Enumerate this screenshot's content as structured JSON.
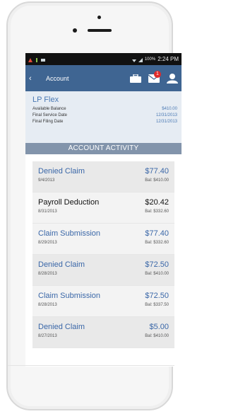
{
  "status_bar": {
    "time": "2:24 PM",
    "battery": "100%"
  },
  "app_bar": {
    "back_label": "‹",
    "title": "Account",
    "mail_badge": "1"
  },
  "summary": {
    "plan_name": "LP Flex",
    "rows": [
      {
        "label": "Available Balance",
        "value": "$410.00"
      },
      {
        "label": "Final Service Date",
        "value": "12/31/2013"
      },
      {
        "label": "Final Filing Date",
        "value": "12/31/2013"
      }
    ]
  },
  "section_title": "ACCOUNT ACTIVITY",
  "activity": [
    {
      "title": "Denied Claim",
      "amount": "$77.40",
      "date": "9/4/2013",
      "balance": "Bal: $410.00",
      "style": "blue"
    },
    {
      "title": "Payroll Deduction",
      "amount": "$20.42",
      "date": "8/31/2013",
      "balance": "Bal: $332.60",
      "style": "dark"
    },
    {
      "title": "Claim Submission",
      "amount": "$77.40",
      "date": "8/29/2013",
      "balance": "Bal: $332.60",
      "style": "blue"
    },
    {
      "title": "Denied Claim",
      "amount": "$72.50",
      "date": "8/28/2013",
      "balance": "Bal: $410.00",
      "style": "blue"
    },
    {
      "title": "Claim Submission",
      "amount": "$72.50",
      "date": "8/28/2013",
      "balance": "Bal: $337.50",
      "style": "blue"
    },
    {
      "title": "Denied Claim",
      "amount": "$5.00",
      "date": "8/27/2013",
      "balance": "Bal: $410.00",
      "style": "blue"
    }
  ],
  "colors": {
    "accent": "#3f6592",
    "link_blue": "#3a67a8",
    "section_header": "#8294ab"
  }
}
